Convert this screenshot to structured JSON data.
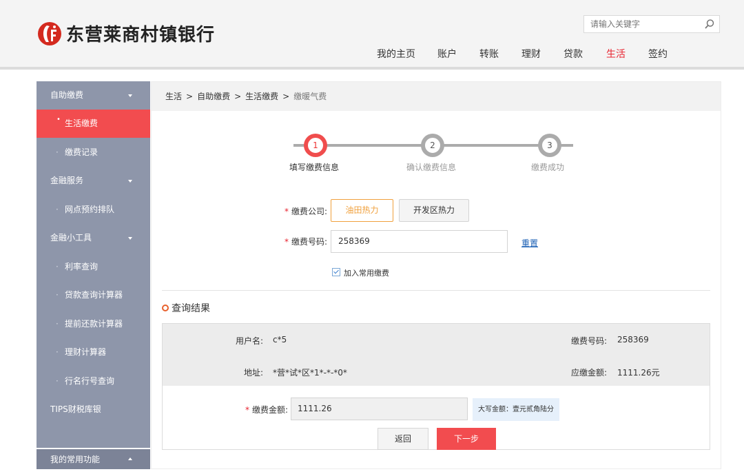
{
  "header": {
    "bank_name": "东营莱商村镇银行",
    "search_placeholder": "请输入关键字",
    "nav": [
      {
        "label": "我的主页"
      },
      {
        "label": "账户"
      },
      {
        "label": "转账"
      },
      {
        "label": "理财"
      },
      {
        "label": "贷款"
      },
      {
        "label": "生活",
        "active": true
      },
      {
        "label": "签约"
      }
    ]
  },
  "sidebar": {
    "items": [
      {
        "label": "自助缴费",
        "type": "group",
        "expanded": true
      },
      {
        "label": "生活缴费",
        "type": "sub",
        "active": true
      },
      {
        "label": "缴费记录",
        "type": "sub"
      },
      {
        "label": "金融服务",
        "type": "group",
        "expanded": true
      },
      {
        "label": "网点预约排队",
        "type": "sub"
      },
      {
        "label": "金融小工具",
        "type": "group",
        "expanded": true
      },
      {
        "label": "利率查询",
        "type": "sub"
      },
      {
        "label": "贷款查询计算器",
        "type": "sub"
      },
      {
        "label": "提前还款计算器",
        "type": "sub"
      },
      {
        "label": "理财计算器",
        "type": "sub"
      },
      {
        "label": "行名行号查询",
        "type": "sub"
      },
      {
        "label": "TIPS财税库银",
        "type": "group"
      }
    ],
    "bottom_label": "我的常用功能"
  },
  "breadcrumb": {
    "items": [
      "生活",
      "自助缴费",
      "生活缴费"
    ],
    "separator": ">",
    "current": "缴暖气费"
  },
  "steps": [
    {
      "number": "1",
      "label": "填写缴费信息",
      "active": true
    },
    {
      "number": "2",
      "label": "确认缴费信息",
      "active": false
    },
    {
      "number": "3",
      "label": "缴费成功",
      "active": false
    }
  ],
  "form": {
    "required_mark": "*",
    "company_label": "缴费公司:",
    "companies": [
      {
        "label": "油田热力",
        "selected": true
      },
      {
        "label": "开发区热力",
        "selected": false
      }
    ],
    "number_label": "缴费号码:",
    "number_value": "258369",
    "reset_label": "重置",
    "add_favorite_label": "加入常用缴费",
    "add_favorite_checked": true
  },
  "result": {
    "title": "查询结果",
    "username_label": "用户名:",
    "username_value": "c*5",
    "address_label": "地址:",
    "address_value": "*营*试*区*1*-*-*0*",
    "pay_number_label": "缴费号码:",
    "pay_number_value": "258369",
    "due_amount_label": "应缴金额:",
    "due_amount_value": "1111.26元",
    "amount_label": "缴费金额:",
    "amount_value": "1111.26",
    "amount_caps": "大写金额：壹元贰角陆分",
    "back_label": "返回",
    "next_label": "下一步"
  },
  "colors": {
    "brand_red": "#e8232f",
    "sidebar_bg": "#8e96aa",
    "active_item_bg": "#f24c4f",
    "selected_orange": "#f0a03c",
    "link_blue": "#1a5fb4"
  }
}
